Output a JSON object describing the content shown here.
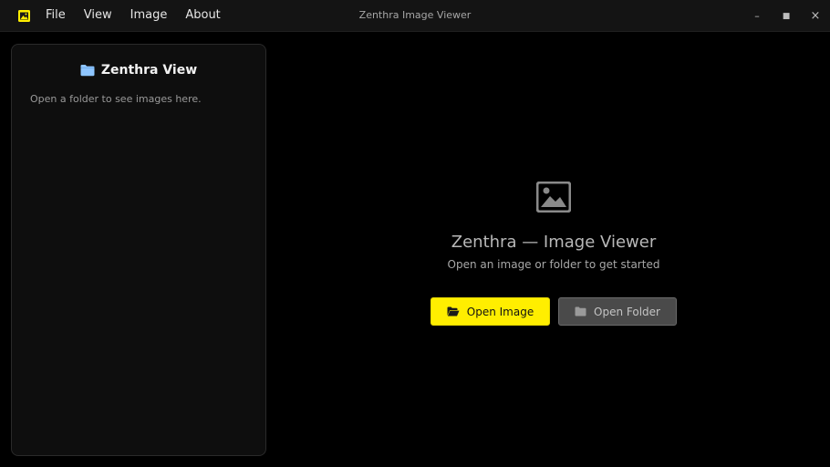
{
  "titlebar": {
    "title": "Zenthra Image Viewer",
    "app_icon": "image-icon",
    "menu": [
      {
        "label": "File"
      },
      {
        "label": "View"
      },
      {
        "label": "Image"
      },
      {
        "label": "About"
      }
    ],
    "controls": {
      "minimize": "–",
      "maximize": "■",
      "close": "×"
    }
  },
  "sidebar": {
    "title": "Zenthra View",
    "title_icon": "folder-icon",
    "empty_text": "Open a folder to see images here."
  },
  "main": {
    "icon": "image-placeholder-icon",
    "heading": "Zenthra — Image Viewer",
    "subheading": "Open an image or folder to get started",
    "buttons": {
      "open_image": {
        "label": "Open Image",
        "icon": "folder-open-icon"
      },
      "open_folder": {
        "label": "Open Folder",
        "icon": "folder-icon"
      }
    }
  },
  "colors": {
    "accent": "#ffee00",
    "background": "#000000",
    "panel": "#0e0e0e",
    "folder_icon": "#8ec5ff"
  }
}
